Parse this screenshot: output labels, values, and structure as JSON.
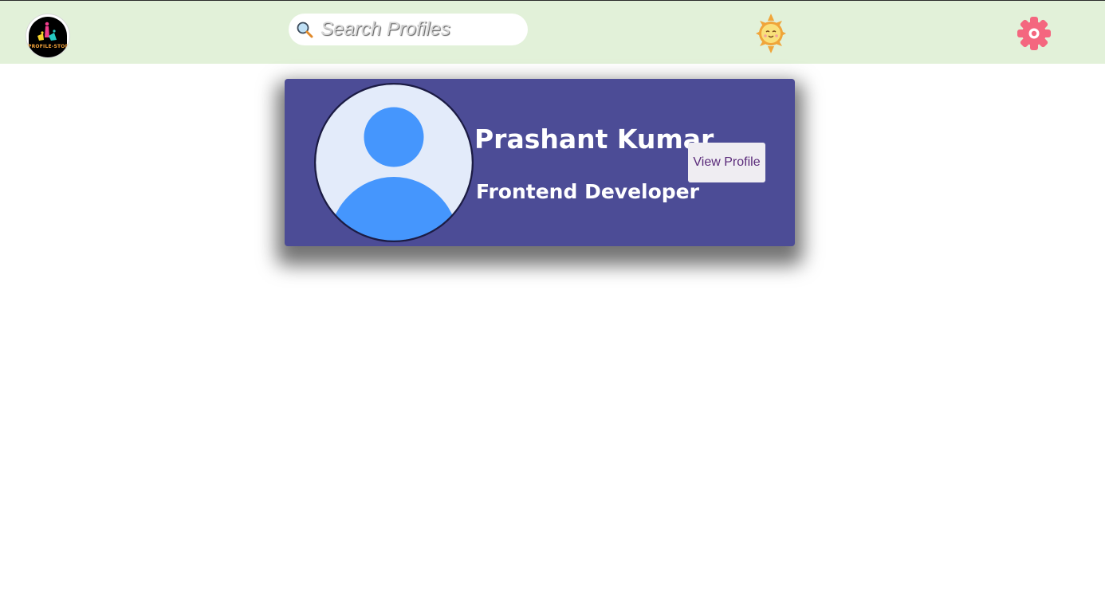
{
  "header": {
    "logo": {
      "icon": "profile-store-logo",
      "text": "PROFILE-STORE"
    },
    "search": {
      "placeholder": "Search Profiles",
      "value": "",
      "icon": "search-icon"
    },
    "theme_toggle": {
      "icon": "sun-icon"
    },
    "settings": {
      "icon": "gear-icon"
    }
  },
  "profile_card": {
    "name": "Prashant Kumar",
    "role": "Frontend Developer",
    "view_button_label": "View Profile",
    "avatar_icon": "user-avatar-icon"
  },
  "colors": {
    "header_bg": "#e2f1d9",
    "card_bg": "#4c4c96",
    "avatar_blue": "#4596fd",
    "avatar_bg": "#e3ebfa",
    "button_text": "#5a2a7a"
  }
}
